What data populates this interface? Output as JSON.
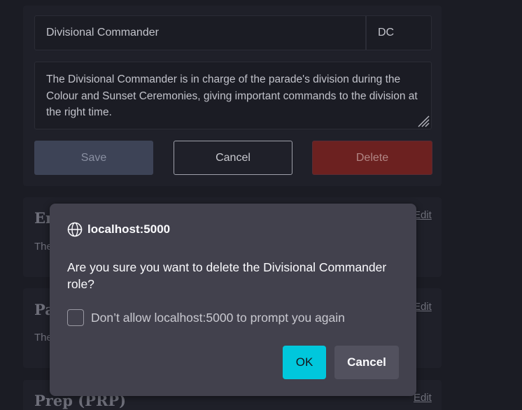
{
  "edit_form": {
    "role_name_value": "Divisional Commander",
    "abbreviation_value": "DC",
    "description_value": "The Divisional Commander is in charge of the parade's division during the Colour and Sunset Ceremonies, giving important commands to the division at the right time.",
    "save_label": "Save",
    "cancel_label": "Cancel",
    "delete_label": "Delete"
  },
  "roles": [
    {
      "title": "En",
      "description": "The",
      "edit_label": "Edit"
    },
    {
      "title": "Pa",
      "description": "The",
      "edit_label": "Edit"
    },
    {
      "title": "Prep (PRP)",
      "edit_label": "Edit"
    }
  ],
  "dialog": {
    "origin": "localhost:5000",
    "message": "Are you sure you want to delete the Divisional Commander role?",
    "checkbox_label": "Don’t allow localhost:5000 to prompt you again",
    "ok_label": "OK",
    "cancel_label": "Cancel"
  },
  "colors": {
    "page_background": "#1b1c24",
    "dialog_background": "#42414d",
    "ok_button": "#00c7dc",
    "delete_button": "#6c2120"
  }
}
